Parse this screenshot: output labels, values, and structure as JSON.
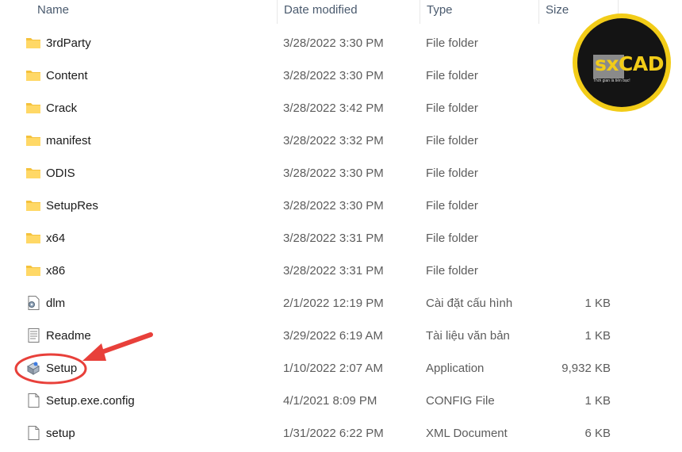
{
  "header": {
    "name": "Name",
    "date": "Date modified",
    "type": "Type",
    "size": "Size"
  },
  "files": [
    {
      "name": "3rdParty",
      "date": "3/28/2022 3:30 PM",
      "type": "File folder",
      "size": "",
      "icon": "folder-icon"
    },
    {
      "name": "Content",
      "date": "3/28/2022 3:30 PM",
      "type": "File folder",
      "size": "",
      "icon": "folder-icon"
    },
    {
      "name": "Crack",
      "date": "3/28/2022 3:42 PM",
      "type": "File folder",
      "size": "",
      "icon": "folder-icon"
    },
    {
      "name": "manifest",
      "date": "3/28/2022 3:32 PM",
      "type": "File folder",
      "size": "",
      "icon": "folder-icon"
    },
    {
      "name": "ODIS",
      "date": "3/28/2022 3:30 PM",
      "type": "File folder",
      "size": "",
      "icon": "folder-icon"
    },
    {
      "name": "SetupRes",
      "date": "3/28/2022 3:30 PM",
      "type": "File folder",
      "size": "",
      "icon": "folder-icon"
    },
    {
      "name": "x64",
      "date": "3/28/2022 3:31 PM",
      "type": "File folder",
      "size": "",
      "icon": "folder-icon"
    },
    {
      "name": "x86",
      "date": "3/28/2022 3:31 PM",
      "type": "File folder",
      "size": "",
      "icon": "folder-icon"
    },
    {
      "name": "dlm",
      "date": "2/1/2022 12:19 PM",
      "type": "Cài đặt cấu hình",
      "size": "1 KB",
      "icon": "config-file-icon"
    },
    {
      "name": "Readme",
      "date": "3/29/2022 6:19 AM",
      "type": "Tài liệu văn bản",
      "size": "1 KB",
      "icon": "text-file-icon"
    },
    {
      "name": "Setup",
      "date": "1/10/2022 2:07 AM",
      "type": "Application",
      "size": "9,932 KB",
      "icon": "setup-app-icon"
    },
    {
      "name": "Setup.exe.config",
      "date": "4/1/2021 8:09 PM",
      "type": "CONFIG File",
      "size": "1 KB",
      "icon": "blank-file-icon"
    },
    {
      "name": "setup",
      "date": "1/31/2022 6:22 PM",
      "type": "XML Document",
      "size": "6 KB",
      "icon": "blank-file-icon"
    }
  ],
  "logo": {
    "text": "sxCAD",
    "tagline": "Thời gian là tiền bạc!"
  },
  "colors": {
    "folder": "#f5c23c",
    "annotation": "#e8403a",
    "logo_ring": "#f2cc18",
    "logo_bg": "#141414"
  }
}
